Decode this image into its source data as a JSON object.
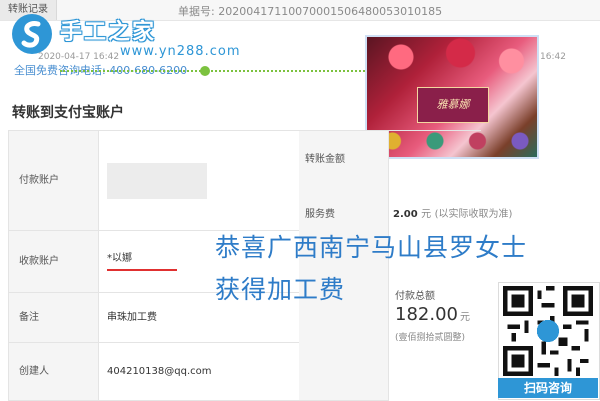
{
  "header": {
    "tab_transfer": "转账记录",
    "order_label": "单据号: 20200417110070001506480053010185"
  },
  "watermark": {
    "title": "手工之家",
    "url": "www.yn288.com",
    "hotline": "全国免费咨询电话: 400-680-6200",
    "brand_color": "#2e96d6"
  },
  "timeline": {
    "time1": "2020-04-17 16:42",
    "time2": "16:42"
  },
  "promo": {
    "badge": "雅慕娜"
  },
  "section_title": "转账到支付宝账户",
  "details": {
    "payer_label": "付款账户",
    "payee_label": "收款账户",
    "payee_value": "*以娜",
    "remark_label": "备注",
    "remark_value": "串珠加工费",
    "creator_label": "创建人",
    "creator_value": "404210138@qq.com"
  },
  "amounts": {
    "transfer_label": "转账金额",
    "fee_label": "服务费",
    "fee_value": "2.00",
    "fee_unit": "元",
    "fee_note": "(以实际收取为准)",
    "total_label": "付款总额",
    "total_value": "182.00",
    "total_unit": "元",
    "total_cn": "(壹佰捌拾贰圆整)"
  },
  "caption": {
    "line1": "恭喜广西南宁马山县罗女士",
    "line2": "获得加工费"
  },
  "qr": {
    "label": "扫码咨询"
  }
}
